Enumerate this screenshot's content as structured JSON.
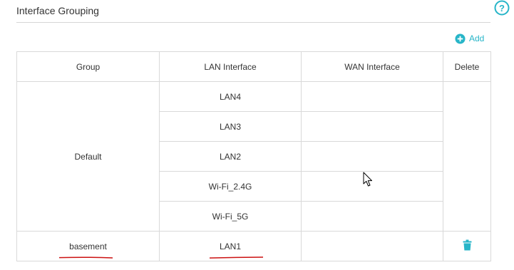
{
  "section": {
    "title": "Interface Grouping"
  },
  "help": {
    "icon": "question-circle-icon"
  },
  "add": {
    "label": "Add",
    "icon": "plus-circle-icon"
  },
  "table": {
    "headers": [
      "Group",
      "LAN Interface",
      "WAN Interface",
      "Delete"
    ],
    "groups": [
      {
        "name": "Default",
        "lan": [
          "LAN4",
          "LAN3",
          "LAN2",
          "Wi-Fi_2.4G",
          "Wi-Fi_5G"
        ],
        "wan": ""
      },
      {
        "name": "basement",
        "lan": [
          "LAN1"
        ],
        "wan": "",
        "delete_icon": "trash-icon"
      }
    ]
  },
  "colors": {
    "accent": "#27b5c8",
    "annotation": "#cc1111",
    "border": "#d9d9d9"
  }
}
